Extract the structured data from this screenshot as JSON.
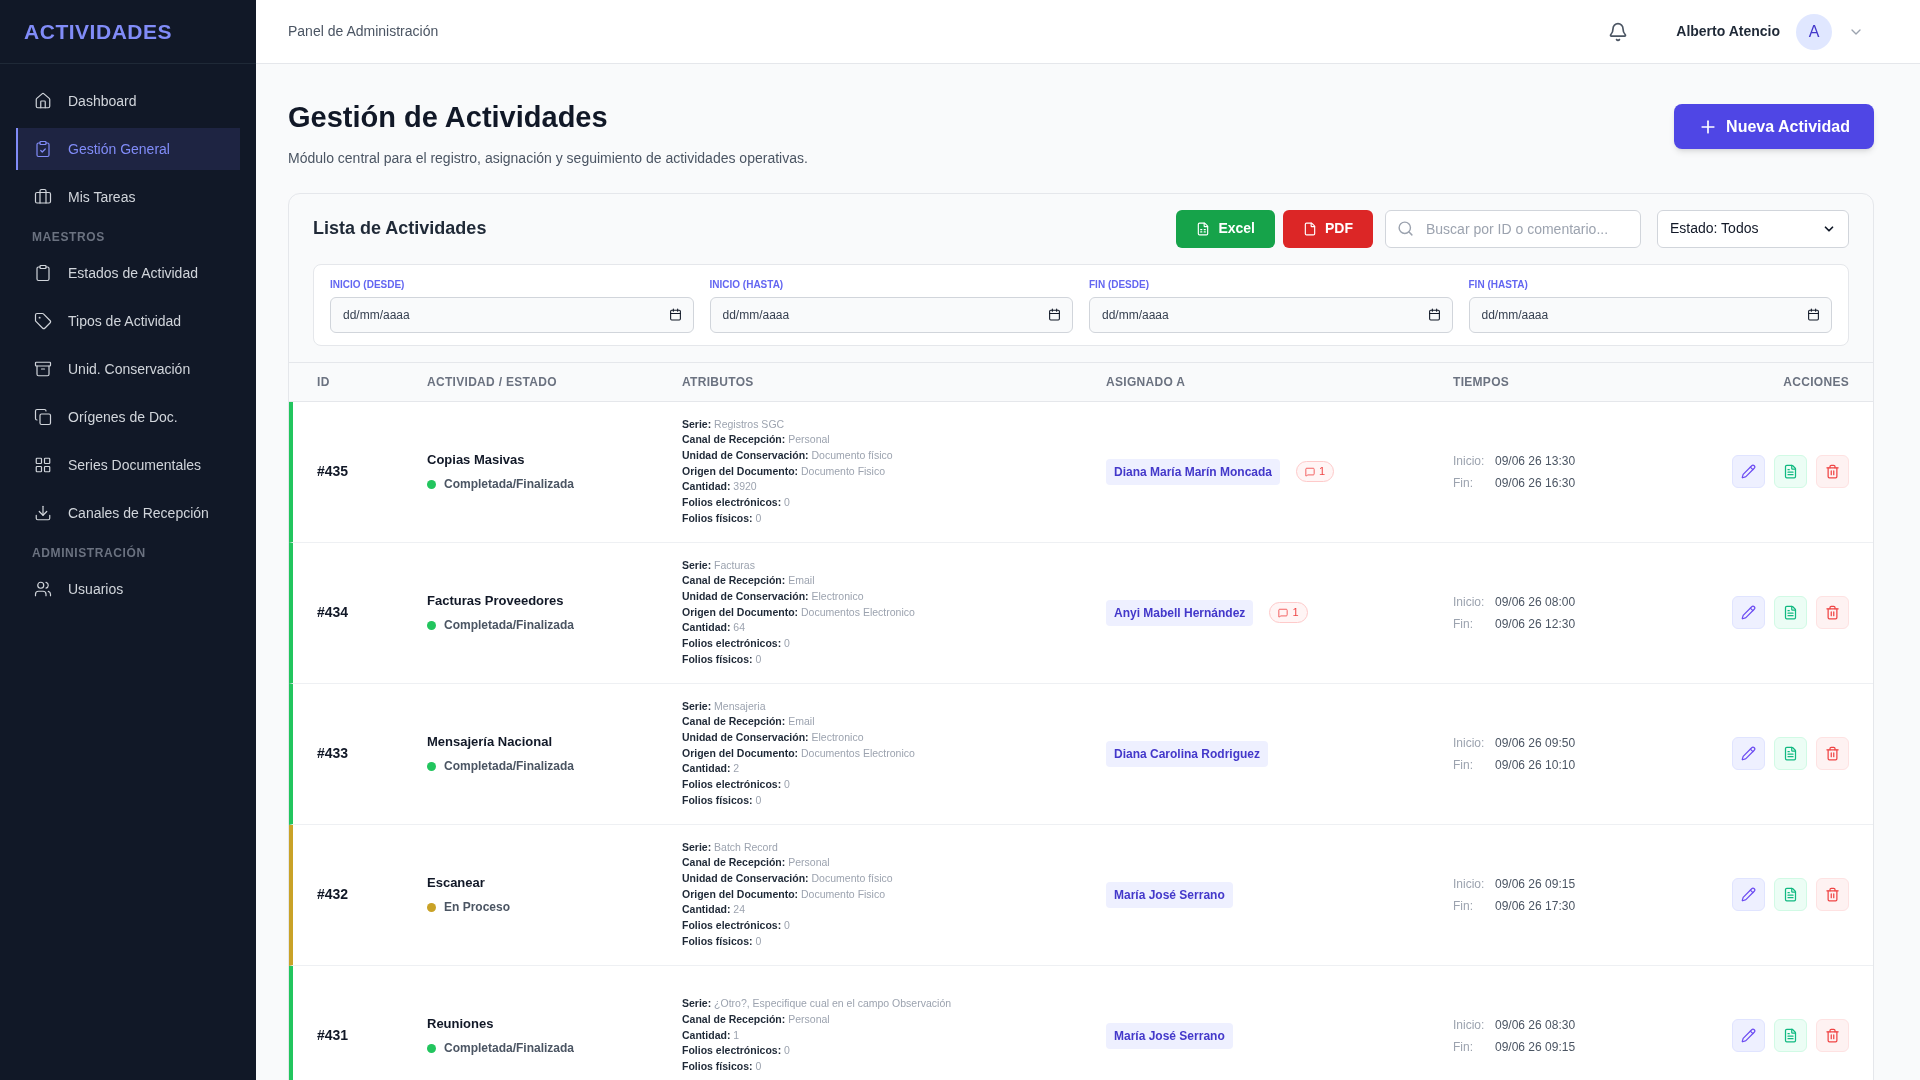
{
  "sidebar": {
    "brand": "ACTIVIDADES",
    "items": [
      {
        "kind": "item",
        "label": "Dashboard",
        "selected": false
      },
      {
        "kind": "item",
        "label": "Gestión General",
        "selected": true
      },
      {
        "kind": "item",
        "label": "Mis Tareas",
        "selected": false
      },
      {
        "kind": "section",
        "label": "MAESTROS"
      },
      {
        "kind": "item",
        "label": "Estados de Actividad",
        "selected": false
      },
      {
        "kind": "item",
        "label": "Tipos de Actividad",
        "selected": false
      },
      {
        "kind": "item",
        "label": "Unid. Conservación",
        "selected": false
      },
      {
        "kind": "item",
        "label": "Orígenes de Doc.",
        "selected": false
      },
      {
        "kind": "item",
        "label": "Series Documentales",
        "selected": false
      },
      {
        "kind": "item",
        "label": "Canales de Recepción",
        "selected": false
      },
      {
        "kind": "section",
        "label": "ADMINISTRACIÓN"
      },
      {
        "kind": "item",
        "label": "Usuarios",
        "selected": false
      }
    ]
  },
  "header": {
    "breadcrumb": "Panel de Administración",
    "user_name": "Alberto Atencio",
    "avatar": "A"
  },
  "page": {
    "title": "Gestión de Actividades",
    "subtitle": "Módulo central para el registro, asignación y seguimiento de actividades operativas.",
    "new_button": "Nueva Actividad"
  },
  "list": {
    "title": "Lista de Actividades",
    "excel_button": "Excel",
    "pdf_button": "PDF",
    "search": {
      "placeholder": "Buscar por ID o comentario..."
    },
    "status_filter": "Estado: Todos",
    "date_filters": [
      {
        "label": "INICIO (DESDE)",
        "placeholder": "dd/mm/aaaa"
      },
      {
        "label": "INICIO (HASTA)",
        "placeholder": "dd/mm/aaaa"
      },
      {
        "label": "FIN (DESDE)",
        "placeholder": "dd/mm/aaaa"
      },
      {
        "label": "FIN (HASTA)",
        "placeholder": "dd/mm/aaaa"
      }
    ],
    "columns": [
      "ID",
      "ACTIVIDAD / ESTADO",
      "ATRIBUTOS",
      "ASIGNADO A",
      "TIEMPOS",
      "ACCIONES"
    ],
    "rows": [
      {
        "id": "#435",
        "activity": "Copias Masivas",
        "status": "Completada/Finalizada",
        "color": "#22c55e",
        "attributes": [
          {
            "label": "Serie:",
            "value": "Registros SGC"
          },
          {
            "label": "Canal de Recepción:",
            "value": "Personal"
          },
          {
            "label": "Unidad de Conservación:",
            "value": "Documento físico"
          },
          {
            "label": "Origen del Documento:",
            "value": "Documento Fisico"
          },
          {
            "label": "Cantidad:",
            "value": "3920"
          },
          {
            "label": "Folios electrónicos:",
            "value": "0"
          },
          {
            "label": "Folios físicos:",
            "value": "0"
          }
        ],
        "assignee": "Diana María Marín Moncada",
        "comments": "1",
        "start_label": "Inicio:",
        "start": "09/06 26 13:30",
        "end_label": "Fin:",
        "end": "09/06 26 16:30"
      },
      {
        "id": "#434",
        "activity": "Facturas Proveedores",
        "status": "Completada/Finalizada",
        "color": "#22c55e",
        "attributes": [
          {
            "label": "Serie:",
            "value": "Facturas"
          },
          {
            "label": "Canal de Recepción:",
            "value": "Email"
          },
          {
            "label": "Unidad de Conservación:",
            "value": "Electronico"
          },
          {
            "label": "Origen del Documento:",
            "value": "Documentos Electronico"
          },
          {
            "label": "Cantidad:",
            "value": "64"
          },
          {
            "label": "Folios electrónicos:",
            "value": "0"
          },
          {
            "label": "Folios físicos:",
            "value": "0"
          }
        ],
        "assignee": "Anyi Mabell Hernández",
        "comments": "1",
        "start_label": "Inicio:",
        "start": "09/06 26 08:00",
        "end_label": "Fin:",
        "end": "09/06 26 12:30"
      },
      {
        "id": "#433",
        "activity": "Mensajería Nacional",
        "status": "Completada/Finalizada",
        "color": "#22c55e",
        "attributes": [
          {
            "label": "Serie:",
            "value": "Mensajeria"
          },
          {
            "label": "Canal de Recepción:",
            "value": "Email"
          },
          {
            "label": "Unidad de Conservación:",
            "value": "Electronico"
          },
          {
            "label": "Origen del Documento:",
            "value": "Documentos Electronico"
          },
          {
            "label": "Cantidad:",
            "value": "2"
          },
          {
            "label": "Folios electrónicos:",
            "value": "0"
          },
          {
            "label": "Folios físicos:",
            "value": "0"
          }
        ],
        "assignee": "Diana Carolina Rodriguez",
        "start_label": "Inicio:",
        "start": "09/06 26 09:50",
        "end_label": "Fin:",
        "end": "09/06 26 10:10"
      },
      {
        "id": "#432",
        "activity": "Escanear",
        "status": "En Proceso",
        "color": "#c9a227",
        "attributes": [
          {
            "label": "Serie:",
            "value": "Batch Record"
          },
          {
            "label": "Canal de Recepción:",
            "value": "Personal"
          },
          {
            "label": "Unidad de Conservación:",
            "value": "Documento físico"
          },
          {
            "label": "Origen del Documento:",
            "value": "Documento Fisico"
          },
          {
            "label": "Cantidad:",
            "value": "24"
          },
          {
            "label": "Folios electrónicos:",
            "value": "0"
          },
          {
            "label": "Folios físicos:",
            "value": "0"
          }
        ],
        "assignee": "María José Serrano",
        "start_label": "Inicio:",
        "start": "09/06 26 09:15",
        "end_label": "Fin:",
        "end": "09/06 26 17:30"
      },
      {
        "id": "#431",
        "activity": "Reuniones",
        "status": "Completada/Finalizada",
        "color": "#22c55e",
        "attributes": [
          {
            "label": "Serie:",
            "value": "¿Otro?, Especifique cual en el campo Observación"
          },
          {
            "label": "Canal de Recepción:",
            "value": "Personal"
          },
          {
            "label": "Cantidad:",
            "value": "1"
          },
          {
            "label": "Folios electrónicos:",
            "value": "0"
          },
          {
            "label": "Folios físicos:",
            "value": "0"
          }
        ],
        "assignee": "María José Serrano",
        "start_label": "Inicio:",
        "start": "09/06 26 08:30",
        "end_label": "Fin:",
        "end": "09/06 26 09:15"
      }
    ]
  }
}
